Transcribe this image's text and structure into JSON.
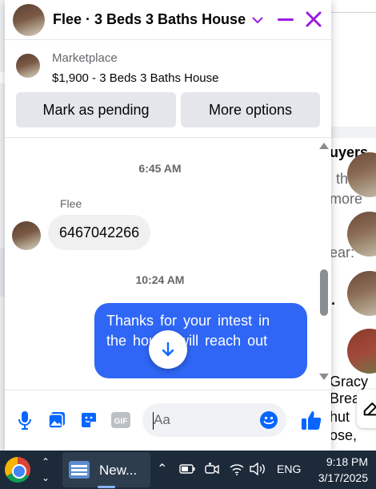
{
  "chat": {
    "title": "Flee · 3 Beds 3 Baths House",
    "marketplace_label": "Marketplace",
    "listing": "$1,900 - 3 Beds 3 Baths House",
    "mark_pending_label": "Mark as pending",
    "more_options_label": "More options"
  },
  "messages": [
    {
      "type": "timestamp",
      "text": "6:45 AM"
    },
    {
      "type": "incoming",
      "sender": "Flee",
      "text": "6467042266"
    },
    {
      "type": "timestamp",
      "text": "10:24 AM"
    },
    {
      "type": "outgoing",
      "text": "Thanks  for  your intest  in the  house  will  reach out"
    }
  ],
  "composer": {
    "placeholder": "Aa"
  },
  "background": {
    "heading_fragment": "uyers",
    "lines": [
      "th",
      "more",
      "ear:",
      ".",
      "Gracy",
      "Brea",
      "hut",
      "ose,"
    ]
  },
  "taskbar": {
    "app_label": "New...",
    "language": "ENG",
    "time": "9:18 PM",
    "date": "3/17/2025"
  },
  "colors": {
    "accent_purple": "#9a1bdd",
    "outgoing_bubble": "#2f66f6",
    "icon_blue": "#0866ff",
    "taskbar": "#1c2a3a"
  }
}
